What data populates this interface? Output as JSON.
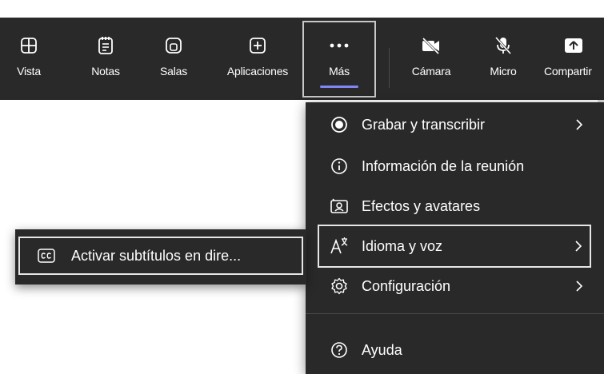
{
  "toolbar": {
    "buttons": [
      {
        "label": "Vista",
        "icon": "grid-icon"
      },
      {
        "label": "Notas",
        "icon": "notes-icon"
      },
      {
        "label": "Salas",
        "icon": "rooms-icon"
      },
      {
        "label": "Aplicaciones",
        "icon": "apps-icon"
      },
      {
        "label": "Más",
        "icon": "more-icon"
      },
      {
        "label": "Cámara",
        "icon": "camera-off-icon"
      },
      {
        "label": "Micro",
        "icon": "mic-off-icon"
      },
      {
        "label": "Compartir",
        "icon": "share-icon"
      }
    ],
    "accent_color": "#7f85f5",
    "background": "#292929"
  },
  "more_menu": {
    "items": [
      {
        "label": "Grabar y transcribir",
        "icon": "record-icon",
        "has_submenu": true
      },
      {
        "label": "Información de la reunión",
        "icon": "info-icon",
        "has_submenu": false
      },
      {
        "label": "Efectos y avatares",
        "icon": "effects-icon",
        "has_submenu": false
      },
      {
        "label": "Idioma y voz",
        "icon": "language-icon",
        "has_submenu": true,
        "selected": true
      },
      {
        "label": "Configuración",
        "icon": "settings-icon",
        "has_submenu": true
      },
      {
        "label": "Ayuda",
        "icon": "help-icon",
        "has_submenu": false
      }
    ]
  },
  "language_submenu": {
    "items": [
      {
        "label": "Activar subtítulos en dire...",
        "icon": "captions-icon"
      }
    ]
  }
}
